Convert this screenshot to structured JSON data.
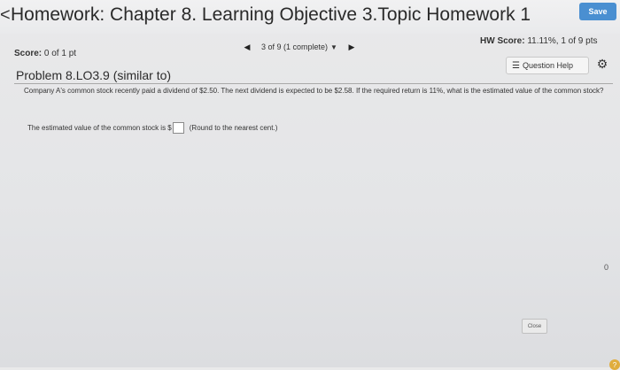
{
  "header": {
    "title": "Homework: Chapter 8. Learning Objective 3.Topic Homework 1",
    "edge_text": "<",
    "save_label": "Save"
  },
  "score": {
    "label": "Score:",
    "value": "0 of 1 pt"
  },
  "pager": {
    "prev_icon": "triangle-left-icon",
    "selector_label": "3 of 9 (1 complete)",
    "next_icon": "triangle-right-icon"
  },
  "hw_score": {
    "label": "HW Score:",
    "value": "11.11%, 1 of 9 pts"
  },
  "question_help": {
    "label": "Question Help",
    "icon": "list-icon"
  },
  "problem": {
    "title": "Problem 8.LO3.9 (similar to)"
  },
  "question": {
    "text": "Company A's common stock recently paid a dividend of $2.50.  The next dividend is expected to be $2.58.  If the required return is 11%, what is the estimated value of the common stock?"
  },
  "answer": {
    "prefix": "The estimated value of the common stock is $",
    "value": "",
    "hint": "(Round to the nearest cent.)"
  },
  "side_text": "0",
  "close_label": "Close",
  "help_badge": "?",
  "colors": {
    "save": "#4a8fd1",
    "help_badge": "#e0ad3e"
  }
}
